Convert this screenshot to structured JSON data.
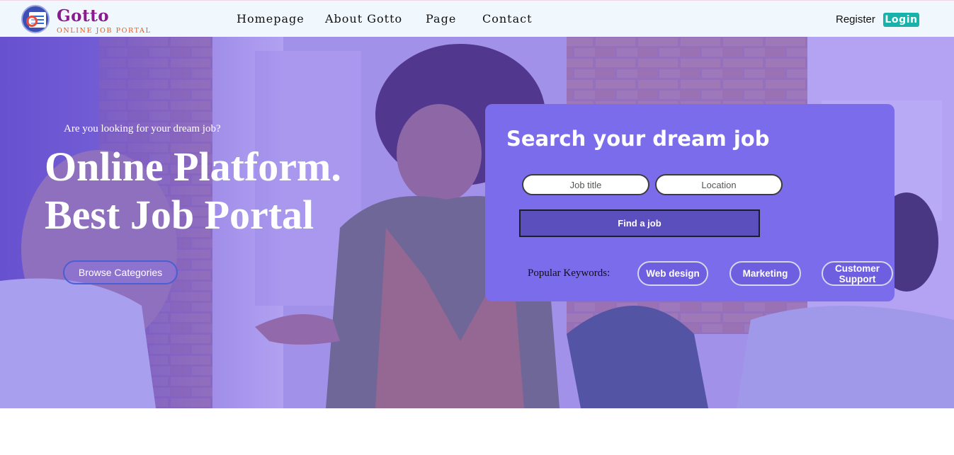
{
  "header": {
    "brand": {
      "name": "Gotto",
      "subtitle": "ONLINE JOB PORTAL",
      "logo_icon": "job-search-magnifier-icon"
    },
    "nav": [
      {
        "label": "Homepage"
      },
      {
        "label": "About Gotto"
      },
      {
        "label": "Page"
      },
      {
        "label": "Contact"
      }
    ],
    "register_label": "Register",
    "login_label": "Login"
  },
  "hero": {
    "tagline": "Are you looking for your dream job?",
    "title_line1": "Online Platform.",
    "title_line2": "Best Job Portal",
    "browse_label": "Browse Categories",
    "background_image": "office meeting photo with purple tint"
  },
  "search": {
    "title": "Search your dream job",
    "job_title_placeholder": "Job title",
    "location_placeholder": "Location",
    "submit_label": "Find a job",
    "popular_label": "Popular Keywords:",
    "keywords": [
      {
        "label": "Web design"
      },
      {
        "label": "Marketing"
      },
      {
        "label": "Customer Support"
      }
    ]
  },
  "colors": {
    "brand": "#8a1b8e",
    "brand_sub": "#e25a1c",
    "login_bg": "#19b2aa",
    "hero_overlay": "#7b5cf0",
    "card_bg": "#7b6ceb",
    "find_button": "#5b4fbd"
  }
}
